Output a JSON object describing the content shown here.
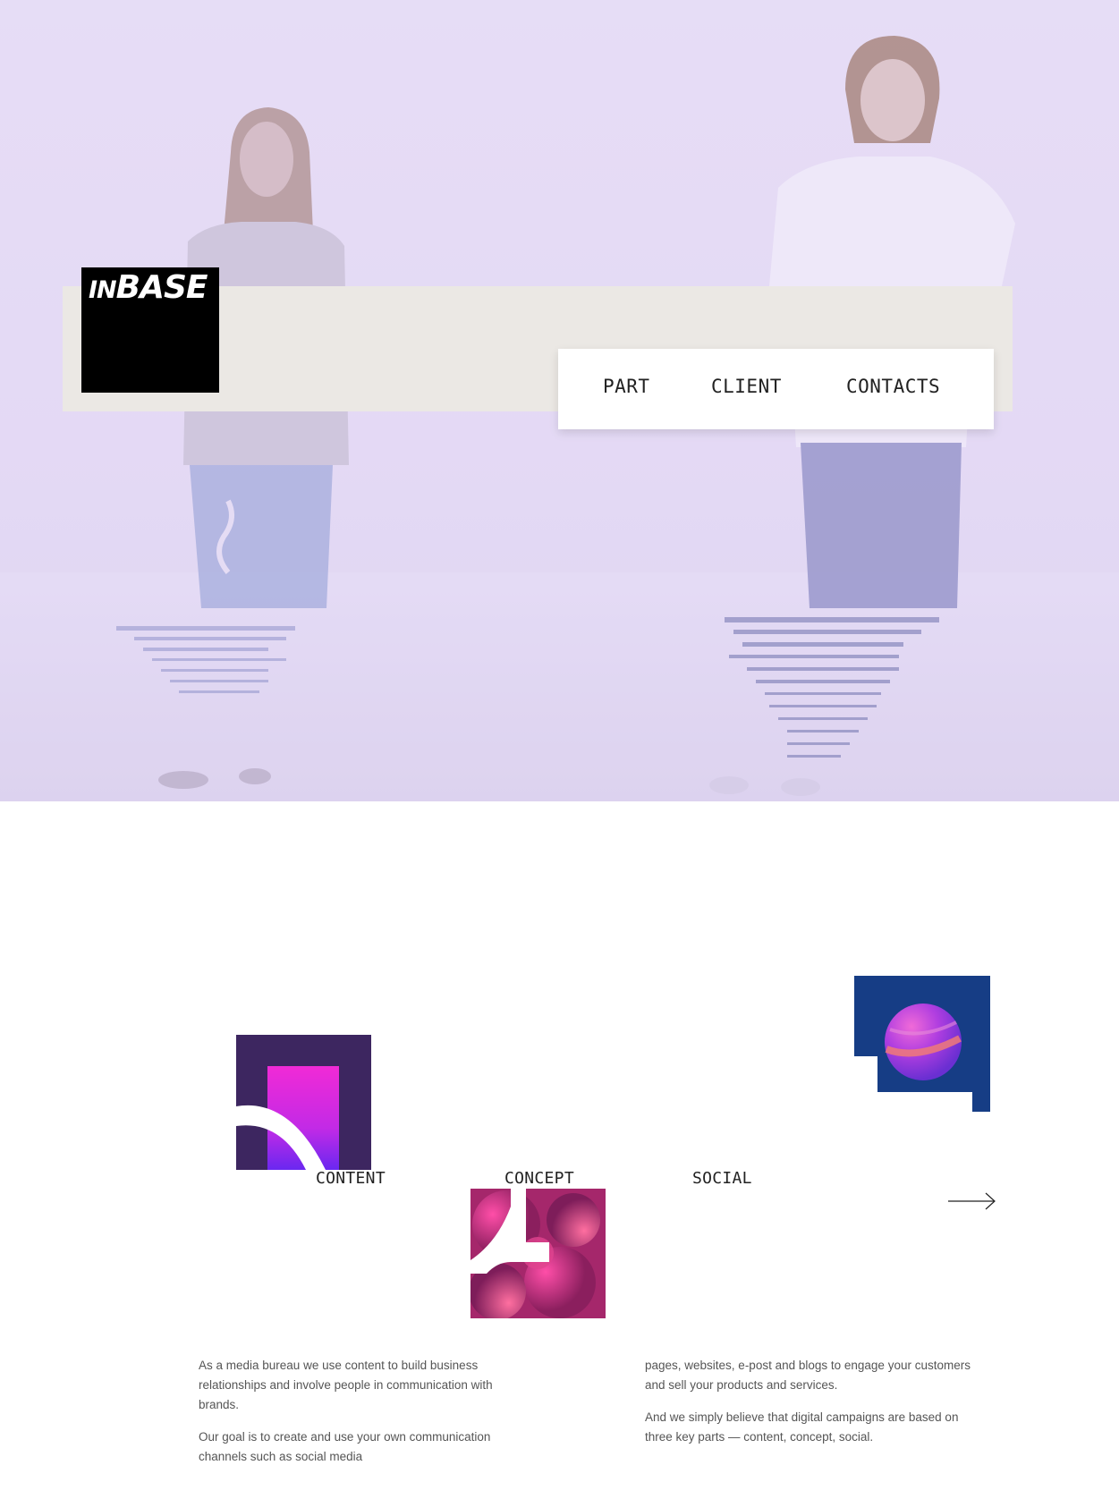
{
  "brand": {
    "logo_prefix": "IN",
    "logo_main": "BASE"
  },
  "nav": {
    "items": [
      {
        "label": "PART"
      },
      {
        "label": "CLIENT"
      },
      {
        "label": "CONTACTS"
      }
    ]
  },
  "services": {
    "items": [
      {
        "label": "CONTENT"
      },
      {
        "label": "CONCEPT"
      },
      {
        "label": "SOCIAL"
      }
    ],
    "next_icon": "arrow-right-icon"
  },
  "about": {
    "left": [
      "As a media bureau we use content to build business relationships and involve people in communication with brands.",
      "Our goal is to create and use your own communication channels such as social media"
    ],
    "right": [
      "pages, websites, e-post and blogs to engage your customers and sell your products and services.",
      "And we simply believe that digital campaigns are based on three key parts — content, concept, social."
    ]
  },
  "colors": {
    "hero_tint": "#e5dbf5",
    "header_bar": "#ebe8e4",
    "content_tile": "#3d2660",
    "social_tile": "#163d85",
    "accent_magenta": "#e42bd7"
  }
}
